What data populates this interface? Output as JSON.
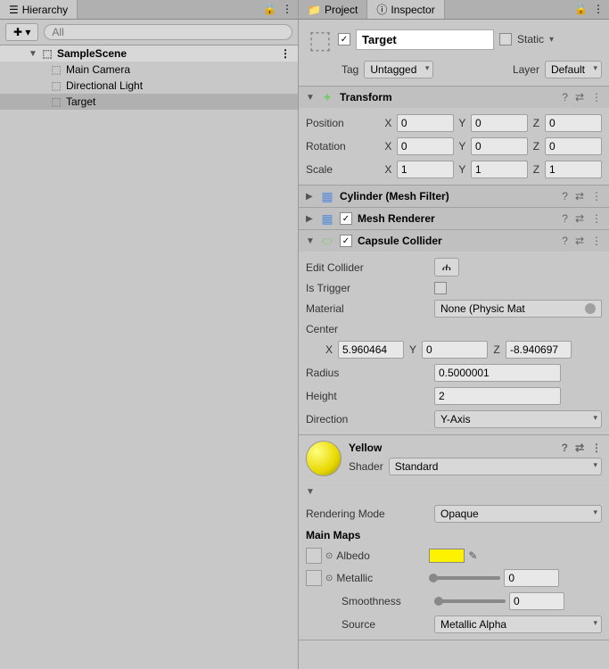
{
  "hierarchy": {
    "tab": "Hierarchy",
    "searchPlaceholder": "All",
    "scene": "SampleScene",
    "items": [
      "Main Camera",
      "Directional Light",
      "Target"
    ]
  },
  "projectTab": "Project",
  "inspectorTab": "Inspector",
  "object": {
    "name": "Target",
    "static": "Static",
    "tagLabel": "Tag",
    "tagValue": "Untagged",
    "layerLabel": "Layer",
    "layerValue": "Default"
  },
  "transform": {
    "title": "Transform",
    "position": {
      "label": "Position",
      "x": "0",
      "y": "0",
      "z": "0"
    },
    "rotation": {
      "label": "Rotation",
      "x": "0",
      "y": "0",
      "z": "0"
    },
    "scale": {
      "label": "Scale",
      "x": "1",
      "y": "1",
      "z": "1"
    }
  },
  "meshFilter": {
    "title": "Cylinder (Mesh Filter)"
  },
  "meshRenderer": {
    "title": "Mesh Renderer"
  },
  "capsule": {
    "title": "Capsule Collider",
    "editCollider": "Edit Collider",
    "isTrigger": "Is Trigger",
    "material": "Material",
    "materialValue": "None (Physic Mat",
    "center": "Center",
    "cx": "5.960464",
    "cy": "0",
    "cz": "-8.940697",
    "radius": "Radius",
    "radiusVal": "0.5000001",
    "height": "Height",
    "heightVal": "2",
    "direction": "Direction",
    "directionVal": "Y-Axis"
  },
  "material": {
    "name": "Yellow",
    "shaderLabel": "Shader",
    "shaderValue": "Standard",
    "renderingMode": "Rendering Mode",
    "renderingModeVal": "Opaque",
    "mainMaps": "Main Maps",
    "albedo": "Albedo",
    "metallic": "Metallic",
    "metallicVal": "0",
    "smoothness": "Smoothness",
    "smoothnessVal": "0",
    "source": "Source",
    "sourceVal": "Metallic Alpha"
  }
}
